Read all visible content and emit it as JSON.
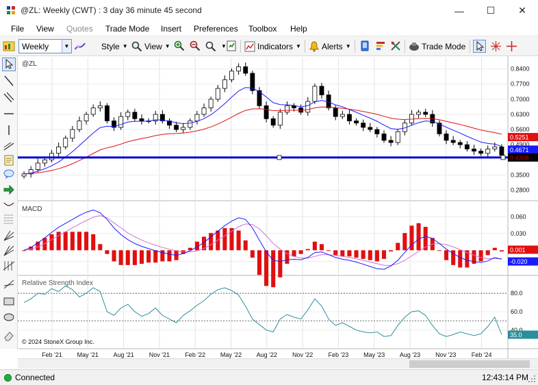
{
  "window": {
    "title": "@ZL: Weekly (CWT) : 3 day 36 minute 45 second",
    "minimize_glyph": "—",
    "maximize_glyph": "☐",
    "close_glyph": "✕"
  },
  "menu": [
    {
      "label": "File",
      "enabled": true
    },
    {
      "label": "View",
      "enabled": true
    },
    {
      "label": "Quotes",
      "enabled": false
    },
    {
      "label": "Trade Mode",
      "enabled": true
    },
    {
      "label": "Insert",
      "enabled": true
    },
    {
      "label": "Preferences",
      "enabled": true
    },
    {
      "label": "Toolbox",
      "enabled": true
    },
    {
      "label": "Help",
      "enabled": true
    }
  ],
  "toolbar": {
    "interval": "Weekly",
    "style_label": "Style",
    "view_label": "View",
    "indicators_label": "Indicators",
    "alerts_label": "Alerts",
    "trade_mode_label": "Trade Mode"
  },
  "status": {
    "connection": "Connected",
    "time": "12:43:14 PM",
    "connected_color": "#1fae3a"
  },
  "chart_data": [
    {
      "type": "candlestick",
      "title": "@ZL",
      "yticks": [
        "0.8400",
        "0.7700",
        "0.7000",
        "0.6300",
        "0.5600",
        "0.4900",
        "0.3500",
        "0.2800"
      ],
      "ylim": [
        0.25,
        0.88
      ],
      "series": [
        {
          "name": "price",
          "color": "#000000"
        },
        {
          "name": "fast average",
          "color": "#1a1aff",
          "last": "0.4671"
        },
        {
          "name": "slow average",
          "color": "#e01010",
          "last": "0.5251"
        }
      ],
      "close": [
        0.355,
        0.375,
        0.405,
        0.42,
        0.45,
        0.48,
        0.52,
        0.56,
        0.6,
        0.63,
        0.66,
        0.67,
        0.6,
        0.57,
        0.62,
        0.64,
        0.61,
        0.6,
        0.6,
        0.63,
        0.6,
        0.58,
        0.56,
        0.57,
        0.6,
        0.63,
        0.66,
        0.7,
        0.75,
        0.79,
        0.83,
        0.85,
        0.82,
        0.74,
        0.67,
        0.61,
        0.58,
        0.64,
        0.67,
        0.66,
        0.64,
        0.69,
        0.76,
        0.72,
        0.66,
        0.62,
        0.63,
        0.6,
        0.59,
        0.57,
        0.56,
        0.54,
        0.51,
        0.5,
        0.55,
        0.59,
        0.63,
        0.64,
        0.63,
        0.59,
        0.54,
        0.51,
        0.5,
        0.49,
        0.47,
        0.46,
        0.45,
        0.47,
        0.48,
        0.44
      ],
      "current_price": "0.4308",
      "current_price_color": "#d00000",
      "horizontal_line_color": "#0000cc"
    },
    {
      "type": "line",
      "title": "MACD",
      "yticks": [
        "0.060",
        "0.030",
        "-0.020"
      ],
      "ylim": [
        -0.04,
        0.075
      ],
      "macd": [
        0.0,
        0.005,
        0.013,
        0.022,
        0.032,
        0.041,
        0.048,
        0.055,
        0.062,
        0.068,
        0.072,
        0.067,
        0.055,
        0.04,
        0.028,
        0.019,
        0.012,
        0.007,
        0.003,
        -0.001,
        -0.004,
        -0.007,
        -0.009,
        -0.006,
        -0.001,
        0.006,
        0.014,
        0.024,
        0.034,
        0.044,
        0.052,
        0.058,
        0.055,
        0.04,
        0.018,
        -0.003,
        -0.018,
        -0.02,
        -0.017,
        -0.016,
        -0.017,
        -0.013,
        -0.004,
        -0.003,
        -0.008,
        -0.013,
        -0.016,
        -0.018,
        -0.021,
        -0.025,
        -0.029,
        -0.033,
        -0.034,
        -0.028,
        -0.018,
        -0.004,
        0.01,
        0.02,
        0.025,
        0.021,
        0.012,
        0.002,
        -0.006,
        -0.013,
        -0.018,
        -0.02,
        -0.022,
        -0.019,
        -0.013,
        -0.016
      ],
      "signal": [
        0.0,
        0.002,
        0.006,
        0.012,
        0.019,
        0.026,
        0.033,
        0.04,
        0.047,
        0.053,
        0.059,
        0.062,
        0.058,
        0.049,
        0.04,
        0.031,
        0.024,
        0.018,
        0.013,
        0.009,
        0.005,
        0.002,
        -0.001,
        -0.003,
        -0.003,
        -0.001,
        0.003,
        0.01,
        0.018,
        0.026,
        0.034,
        0.042,
        0.047,
        0.046,
        0.038,
        0.026,
        0.012,
        0.002,
        -0.006,
        -0.011,
        -0.014,
        -0.014,
        -0.011,
        -0.008,
        -0.008,
        -0.009,
        -0.011,
        -0.013,
        -0.015,
        -0.018,
        -0.021,
        -0.024,
        -0.027,
        -0.027,
        -0.024,
        -0.018,
        -0.01,
        -0.002,
        0.006,
        0.011,
        0.012,
        0.01,
        0.006,
        0.001,
        -0.004,
        -0.009,
        -0.013,
        -0.015,
        -0.015,
        -0.015
      ],
      "histogram_color_pos": "#e01010",
      "histogram_color_neg": "#e01010",
      "macd_color": "#1a1aff",
      "signal_color": "#d070d0",
      "last_macd": "0.001",
      "last_signal": "-0.020"
    },
    {
      "type": "line",
      "title": "Relative Strength Index",
      "yticks": [
        "80.0",
        "60.0",
        "40.0"
      ],
      "ylim": [
        22,
        95
      ],
      "guides": [
        80,
        50
      ],
      "values": [
        70,
        74,
        80,
        79,
        85,
        82,
        88,
        84,
        76,
        80,
        86,
        82,
        60,
        56,
        64,
        68,
        60,
        55,
        58,
        64,
        56,
        52,
        48,
        56,
        61,
        67,
        72,
        79,
        84,
        86,
        83,
        78,
        66,
        52,
        46,
        40,
        38,
        52,
        57,
        54,
        52,
        62,
        74,
        66,
        52,
        45,
        48,
        44,
        40,
        38,
        37,
        38,
        33,
        34,
        45,
        54,
        60,
        61,
        56,
        45,
        36,
        33,
        35,
        38,
        36,
        34,
        36,
        44,
        54,
        35
      ],
      "color": "#2a8f9a",
      "last": "35.0",
      "footer": "© 2024 StoneX Group Inc."
    }
  ],
  "x_axis": [
    "Feb '21",
    "May '21",
    "Aug '21",
    "Nov '21",
    "Feb '22",
    "May '22",
    "Aug '22",
    "Nov '22",
    "Feb '23",
    "May '23",
    "Aug '23",
    "Nov '23",
    "Feb '24"
  ]
}
